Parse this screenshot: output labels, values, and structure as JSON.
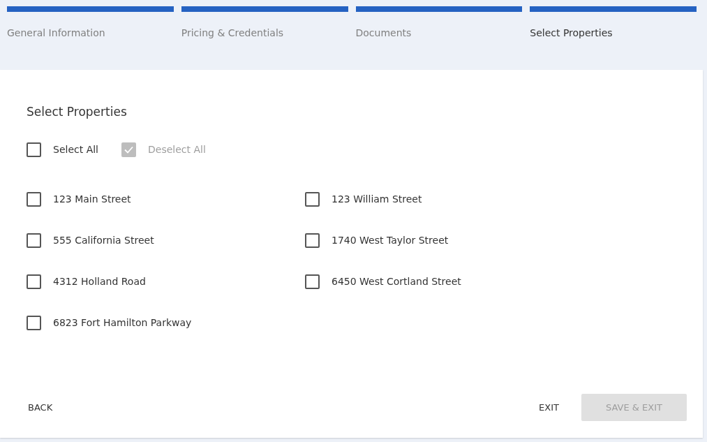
{
  "steps": [
    {
      "label": "General Information",
      "selected": false,
      "completed": true
    },
    {
      "label": "Pricing & Credentials",
      "selected": false,
      "completed": true
    },
    {
      "label": "Documents",
      "selected": false,
      "completed": true
    },
    {
      "label": "Select Properties",
      "selected": true,
      "completed": true
    }
  ],
  "panel": {
    "title": "Select Properties",
    "bulk_options": [
      {
        "label": "Select All",
        "checked": false,
        "disabled": false
      },
      {
        "label": "Deselect All",
        "checked": true,
        "disabled": true
      }
    ],
    "properties": [
      {
        "label": "123 Main Street",
        "checked": false
      },
      {
        "label": "123 William Street",
        "checked": false
      },
      {
        "label": "555 California Street",
        "checked": false
      },
      {
        "label": "1740 West Taylor Street",
        "checked": false
      },
      {
        "label": "4312 Holland Road",
        "checked": false
      },
      {
        "label": "6450 West Cortland Street",
        "checked": false
      },
      {
        "label": "6823 Fort Hamilton Parkway",
        "checked": false
      }
    ],
    "buttons": {
      "back": {
        "label": "BACK"
      },
      "exit": {
        "label": "EXIT"
      },
      "save": {
        "label": "SAVE & EXIT",
        "disabled": true
      }
    }
  }
}
